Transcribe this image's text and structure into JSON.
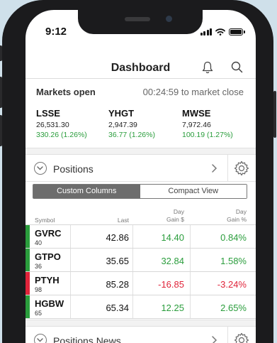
{
  "status_bar": {
    "time": "9:12"
  },
  "header": {
    "title": "Dashboard"
  },
  "markets": {
    "status": "Markets open",
    "timer": "00:24:59 to market close",
    "indices": [
      {
        "name": "LSSE",
        "value": "26,531.30",
        "change": "330.26 (1.26%)"
      },
      {
        "name": "YHGT",
        "value": "2,947.39",
        "change": "36.77 (1.26%)"
      },
      {
        "name": "MWSE",
        "value": "7,972.46",
        "change": "100.19 (1.27%)"
      }
    ]
  },
  "positions": {
    "title": "Positions",
    "toggle": {
      "active": "Custom Columns",
      "inactive": "Compact View"
    },
    "columns": {
      "symbol": "Symbol",
      "last": "Last",
      "day_gain_dollar": {
        "line1": "Day",
        "line2": "Gain $"
      },
      "day_gain_pct": {
        "line1": "Day",
        "line2": "Gain %"
      }
    },
    "rows": [
      {
        "symbol": "GVRC",
        "qty": "40",
        "last": "42.86",
        "gain": "14.40",
        "gain_pct": "0.84%",
        "direction": "up"
      },
      {
        "symbol": "GTPO",
        "qty": "36",
        "last": "35.65",
        "gain": "32.84",
        "gain_pct": "1.58%",
        "direction": "up"
      },
      {
        "symbol": "PTYH",
        "qty": "98",
        "last": "85.28",
        "gain": "-16.85",
        "gain_pct": "-3.24%",
        "direction": "down"
      },
      {
        "symbol": "HGBW",
        "qty": "65",
        "last": "65.34",
        "gain": "12.25",
        "gain_pct": "2.65%",
        "direction": "up"
      }
    ]
  },
  "news": {
    "title": "Positions News"
  },
  "colors": {
    "up": "#2a9d3c",
    "down": "#e0243a"
  }
}
